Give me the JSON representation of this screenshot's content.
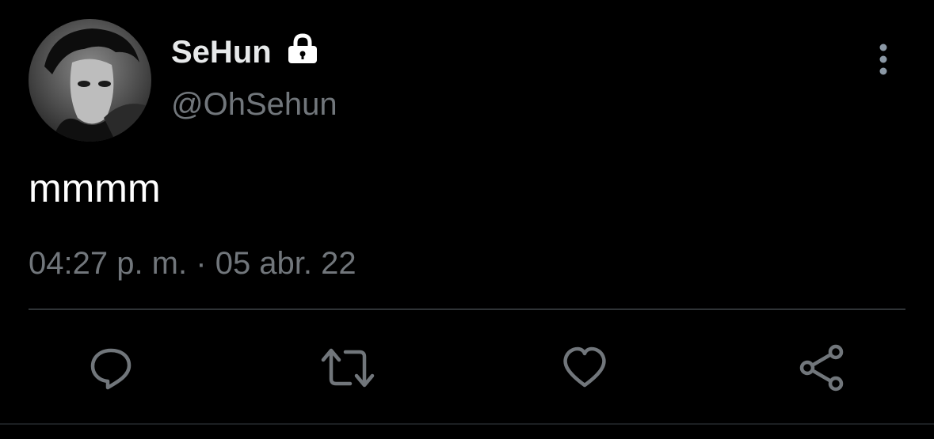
{
  "tweet": {
    "display_name": "SeHun",
    "protected": true,
    "handle": "@OhSehun",
    "text": "mmmm",
    "time": "04:27 p. m.",
    "separator": "·",
    "date": "05 abr. 22"
  },
  "actions": [
    {
      "name": "reply",
      "icon": "comment-icon"
    },
    {
      "name": "retweet",
      "icon": "retweet-icon"
    },
    {
      "name": "like",
      "icon": "heart-icon"
    },
    {
      "name": "share",
      "icon": "share-icon"
    }
  ],
  "colors": {
    "background": "#000000",
    "primary_text": "#e7e9ea",
    "secondary_text": "#71767b",
    "divider": "#2f3336"
  }
}
